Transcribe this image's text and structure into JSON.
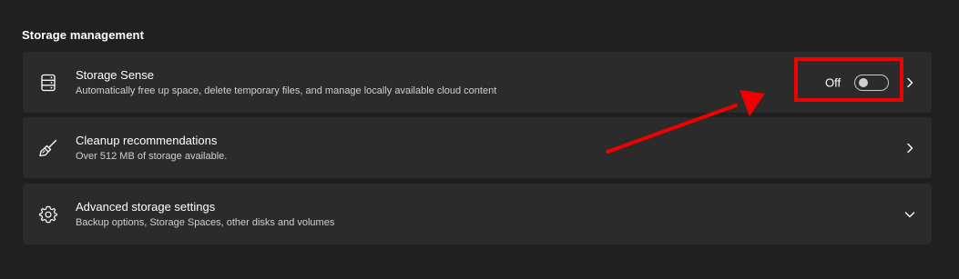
{
  "section": {
    "title": "Storage management"
  },
  "cards": [
    {
      "title": "Storage Sense",
      "subtitle": "Automatically free up space, delete temporary files, and manage locally available cloud content",
      "icon": "storage-drive-icon",
      "toggle_label": "Off",
      "toggle_state": "off",
      "trailing_icon": "chevron-right-icon"
    },
    {
      "title": "Cleanup recommendations",
      "subtitle": "Over 512 MB of storage available.",
      "icon": "broom-icon",
      "trailing_icon": "chevron-right-icon"
    },
    {
      "title": "Advanced storage settings",
      "subtitle": "Backup options, Storage Spaces, other disks and volumes",
      "icon": "gear-icon",
      "trailing_icon": "chevron-down-icon"
    }
  ],
  "annotation": {
    "color": "#f00000"
  }
}
